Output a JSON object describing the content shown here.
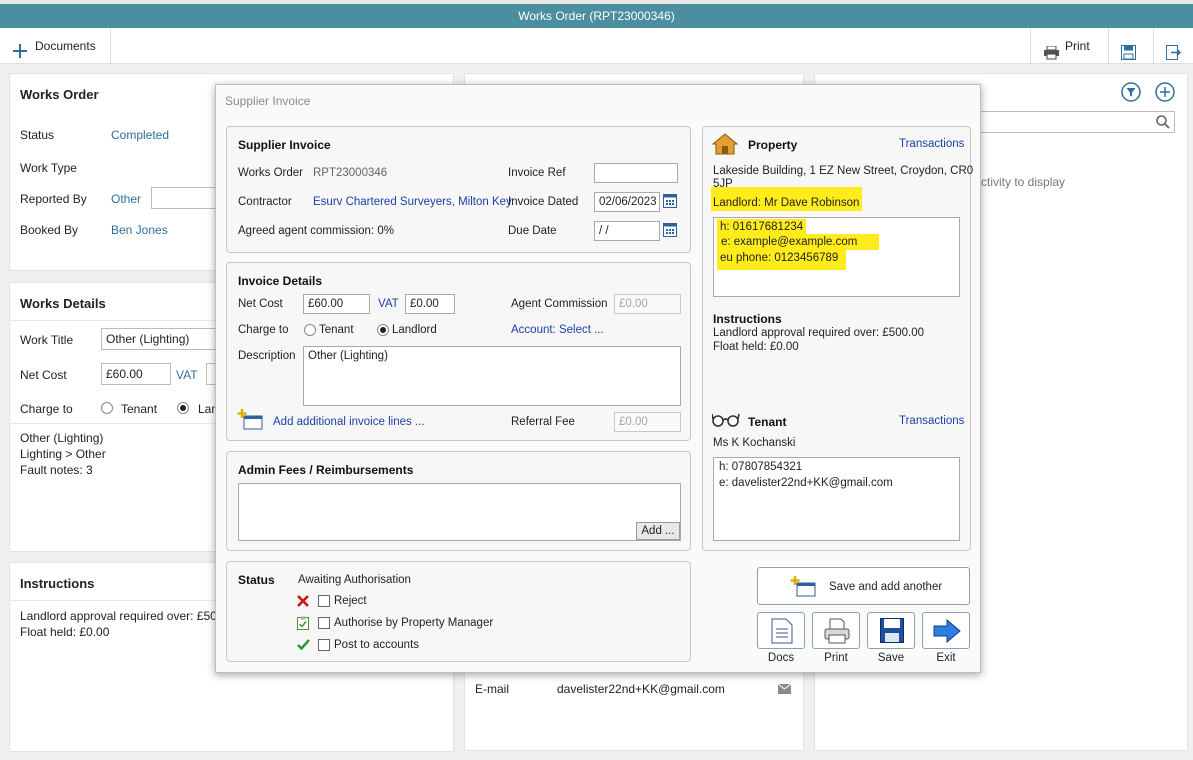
{
  "window": {
    "title": "Works Order (RPT23000346)"
  },
  "toolbar": {
    "documents_label": "Documents",
    "print_label": "Print"
  },
  "works_order": {
    "title": "Works Order",
    "status_label": "Status",
    "status_value": "Completed",
    "work_type_label": "Work Type",
    "reported_by_label": "Reported By",
    "reported_by_value": "Other",
    "booked_by_label": "Booked By",
    "booked_by_value": "Ben Jones"
  },
  "works_details": {
    "title": "Works Details",
    "work_title_label": "Work Title",
    "work_title_value": "Other (Lighting)",
    "net_cost_label": "Net Cost",
    "net_cost_value": "£60.00",
    "vat_label": "VAT",
    "charge_to_label": "Charge to",
    "tenant_label": "Tenant",
    "landlord_label": "Lan",
    "notes": [
      "Other (Lighting)",
      "Lighting > Other",
      "Fault notes: 3"
    ]
  },
  "instructions_panel": {
    "title": "Instructions",
    "lines": [
      "Landlord approval required over: £50",
      "Float held: £0.00"
    ]
  },
  "contact_panel": {
    "email_label": "E-mail",
    "email_value": "davelister22nd+KK@gmail.com"
  },
  "activity_panel": {
    "empty_text": "ctivity to display"
  },
  "modal": {
    "title": "Supplier Invoice",
    "supplier_invoice": {
      "title": "Supplier Invoice",
      "works_order_label": "Works Order",
      "works_order_value": "RPT23000346",
      "invoice_ref_label": "Invoice Ref",
      "invoice_ref_value": "",
      "contractor_label": "Contractor",
      "contractor_value": "Esurv Chartered Surveyers, Milton Key",
      "invoice_dated_label": "Invoice Dated",
      "invoice_dated_value": "02/06/2023",
      "agreed_commission_label": "Agreed agent commission: 0%",
      "due_date_label": "Due Date",
      "due_date_value": " /  /"
    },
    "invoice_details": {
      "title": "Invoice Details",
      "net_cost_label": "Net Cost",
      "net_cost_value": "£60.00",
      "vat_label": "VAT",
      "vat_value": "£0.00",
      "agent_commission_label": "Agent Commission",
      "agent_commission_value": "£0.00",
      "charge_to_label": "Charge to",
      "tenant_label": "Tenant",
      "landlord_label": "Landlord",
      "account_label": "Account: Select ...",
      "description_label": "Description",
      "description_value": "Other (Lighting)",
      "add_lines_label": "Add additional invoice lines ...",
      "referral_fee_label": "Referral Fee",
      "referral_fee_value": "£0.00"
    },
    "admin_fees": {
      "title": "Admin Fees / Reimbursements",
      "add_label": "Add ..."
    },
    "status": {
      "title": "Status",
      "value": "Awaiting Authorisation",
      "reject_label": "Reject",
      "authorise_label": "Authorise by Property Manager",
      "post_label": "Post to accounts"
    },
    "property": {
      "title": "Property",
      "transactions_label": "Transactions",
      "address_line1": "Lakeside Building, 1 EZ New Street, Croydon, CR0",
      "address_line2": "5JP",
      "landlord": "Landlord: Mr Dave Robinson",
      "contacts": [
        "h: 01617681234",
        "e: example@example.com",
        "eu phone: 0123456789"
      ],
      "instructions_title": "Instructions",
      "instructions_lines": [
        "Landlord approval required over: £500.00",
        "Float held: £0.00"
      ]
    },
    "tenant": {
      "title": "Tenant",
      "transactions_label": "Transactions",
      "name": "Ms K Kochanski",
      "contacts": [
        "h: 07807854321",
        "e: davelister22nd+KK@gmail.com"
      ]
    },
    "buttons": {
      "save_add_another": "Save and add another",
      "docs": "Docs",
      "print": "Print",
      "save": "Save",
      "exit": "Exit"
    }
  }
}
